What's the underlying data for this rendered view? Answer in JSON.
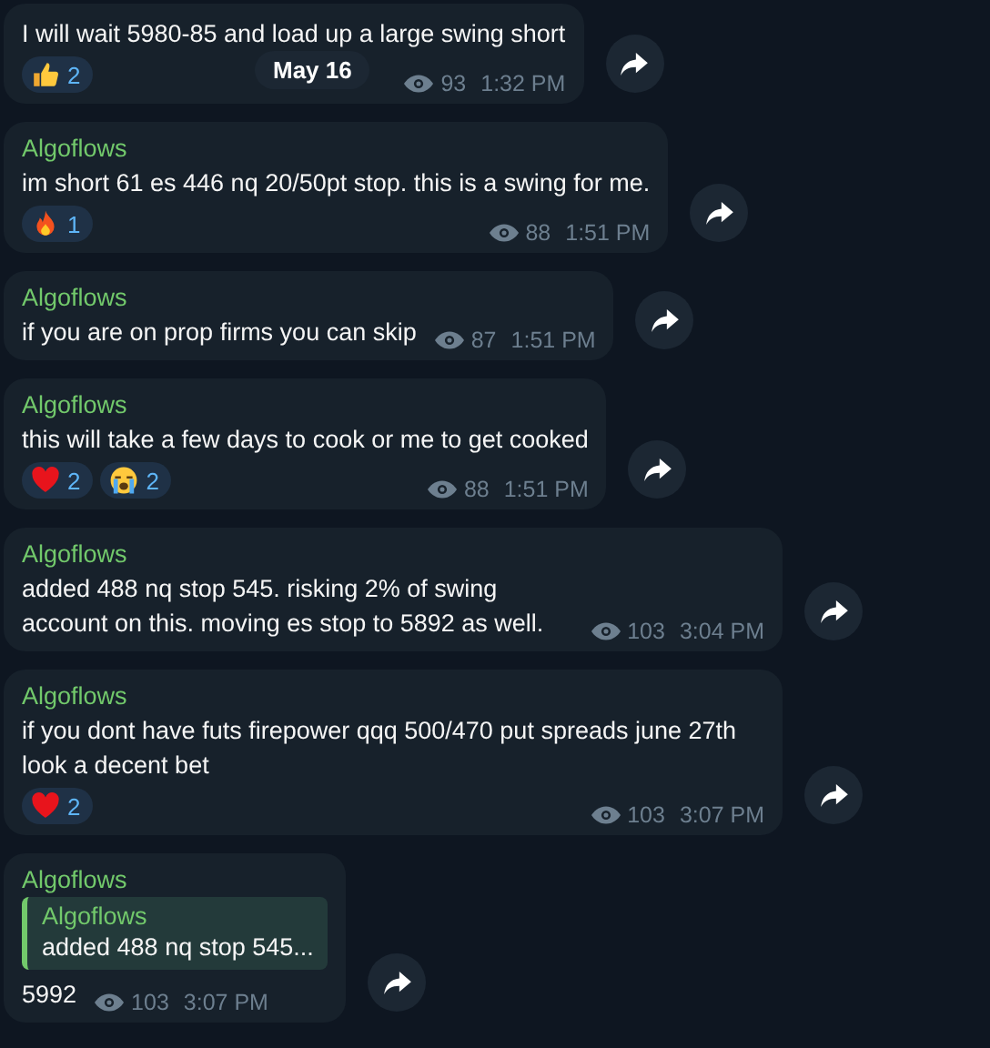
{
  "date_pill": "May 16",
  "messages": [
    {
      "kind": "plain",
      "text": "I will wait 5980-85 and load up a large swing short",
      "reactions": [
        {
          "kind": "thumbs",
          "count": "2"
        }
      ],
      "views": "93",
      "time": "1:32 PM"
    },
    {
      "kind": "plain",
      "sender": "Algoflows",
      "text": "im short 61 es 446 nq 20/50pt stop. this is a swing for me.",
      "reactions": [
        {
          "kind": "fire",
          "count": "1"
        }
      ],
      "views": "88",
      "time": "1:51 PM"
    },
    {
      "kind": "plain",
      "sender": "Algoflows",
      "text": "if you are on prop firms you can skip",
      "views": "87",
      "time": "1:51 PM"
    },
    {
      "kind": "plain",
      "sender": "Algoflows",
      "text": "this will take a few days to cook or me to get cooked",
      "reactions": [
        {
          "kind": "heart",
          "count": "2"
        },
        {
          "kind": "crying",
          "count": "2"
        }
      ],
      "views": "88",
      "time": "1:51 PM"
    },
    {
      "kind": "plain",
      "sender": "Algoflows",
      "text": "added 488 nq stop 545. risking 2% of swing account on this. moving es stop to 5892 as well.",
      "views": "103",
      "time": "3:04 PM"
    },
    {
      "kind": "plain",
      "sender": "Algoflows",
      "text": "if you dont have futs firepower qqq 500/470 put spreads june 27th look a decent bet",
      "reactions": [
        {
          "kind": "heart",
          "count": "2"
        }
      ],
      "views": "103",
      "time": "3:07 PM"
    },
    {
      "kind": "reply",
      "sender": "Algoflows",
      "quote": {
        "sender": "Algoflows",
        "text": "added 488 nq stop 545..."
      },
      "text": "5992",
      "views": "103",
      "time": "3:07 PM"
    }
  ]
}
